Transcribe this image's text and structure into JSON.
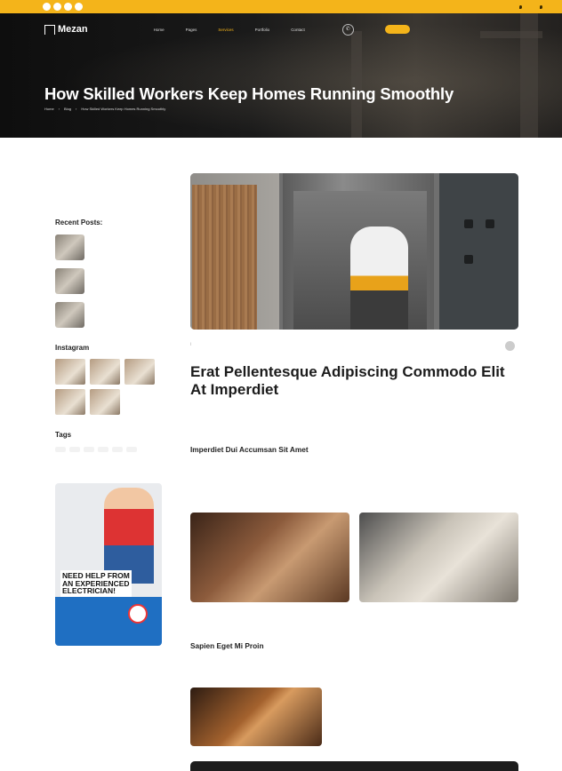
{
  "topbar": {
    "social": [
      "facebook-icon",
      "twitter-icon",
      "linkedin-icon",
      "instagram-icon"
    ],
    "address": "",
    "email": ""
  },
  "nav": {
    "logo": "Mezan",
    "menu": [
      "Home",
      "Pages",
      "Services",
      "Portfolio",
      "Contact"
    ],
    "active_index": 2,
    "call_label": "",
    "call_number": "",
    "cta": ""
  },
  "hero": {
    "title": "How Skilled Workers Keep Homes Running Smoothly",
    "breadcrumbs": [
      "Home",
      "Blog",
      "How Skilled Workers Keep Homes Running Smoothly"
    ]
  },
  "sidebar": {
    "search_placeholder": "",
    "recent_title": "Recent Posts:",
    "recent_posts": [
      {
        "date": "",
        "title": ""
      },
      {
        "date": "",
        "title": ""
      },
      {
        "date": "",
        "title": ""
      }
    ],
    "instagram_title": "Instagram",
    "tags_title": "Tags",
    "tags": [
      "",
      "",
      "",
      "",
      "",
      ""
    ],
    "ad": {
      "brand": "",
      "headline": "NEED HELP FROM AN EXPERIENCED ELECTRICIAN!",
      "call_label": "",
      "phone": "",
      "seal": ""
    }
  },
  "post": {
    "date": "",
    "category": "",
    "author": "",
    "title": "Erat Pellentesque Adipiscing Commodo Elit At Imperdiet",
    "intro": "",
    "section1_title": "Imperdiet Dui Accumsan Sit Amet",
    "section1_p1": "",
    "section1_p2": "",
    "caption": "",
    "section2_title": "Sapien Eget Mi Proin",
    "section2_p": "",
    "list": [
      "",
      "",
      "",
      "",
      ""
    ]
  },
  "colors": {
    "accent": "#f4b41a",
    "hero_bg": "#111111",
    "ad_blue": "#1f6fc2"
  }
}
